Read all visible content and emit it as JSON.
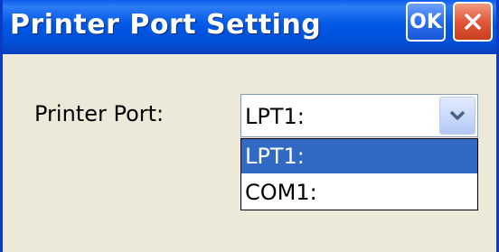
{
  "window": {
    "title": "Printer Port Setting",
    "ok_label": "OK"
  },
  "form": {
    "port_label": "Printer Port:",
    "port_value": "LPT1:"
  },
  "dropdown": {
    "options": [
      "LPT1:",
      "COM1:"
    ],
    "highlighted_index": 0
  },
  "colors": {
    "titlebar": "#0058E6",
    "selection": "#316AC5",
    "close_button": "#E2563A",
    "window_background": "#ECE9D8"
  }
}
